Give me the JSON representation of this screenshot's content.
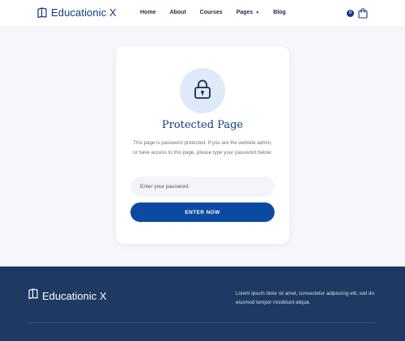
{
  "brand": {
    "name": "Educationic X"
  },
  "nav": {
    "items": [
      "Home",
      "About",
      "Courses",
      "Pages",
      "Blog"
    ]
  },
  "cart": {
    "count": "0"
  },
  "card": {
    "title": "Protected Page",
    "description": "This page is password protected. If you are the website admin, or have access to this page, please type your password below.",
    "password_placeholder": "Enter your password",
    "submit_label": "ENTER NOW"
  },
  "footer": {
    "brand": "Educationic X",
    "text": "Lorem ipsum dolor sit amet, consectetur adipiscing elit, sed do eiusmod tempor incididunt  aliqua."
  },
  "colors": {
    "brand": "#0d3b82",
    "button": "#0b4aa0",
    "footer_bg": "#1e3a63",
    "lock_circle": "#dfeaf9"
  },
  "icons": [
    "book-logo-icon",
    "chevron-down-icon",
    "shopping-bag-icon",
    "lock-icon"
  ]
}
